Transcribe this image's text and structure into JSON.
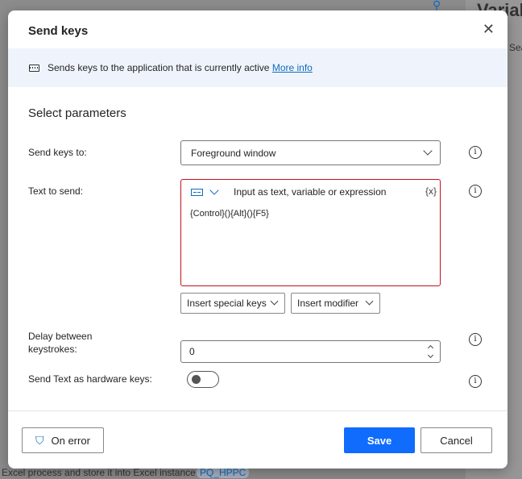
{
  "background": {
    "right_panel_title": "Variab",
    "right_search": "Sea",
    "bottom_text": "Excel process and store it into Excel instance",
    "bottom_variable": "PQ_HPPC"
  },
  "dialog": {
    "title": "Send keys",
    "description": "Sends keys to the application that is currently active",
    "more_info": "More info",
    "section_title": "Select parameters",
    "send_keys_to": {
      "label": "Send keys to:",
      "value": "Foreground window"
    },
    "text_to_send": {
      "label": "Text to send:",
      "mode_hint": "Input as text, variable or expression",
      "var_button": "{x}",
      "value": "{Control}(){Alt}(){F5}"
    },
    "insert_special_keys": "Insert special keys",
    "insert_modifier": "Insert modifier",
    "delay": {
      "label_line1": "Delay between",
      "label_line2": "keystrokes:",
      "value": "0"
    },
    "hardware_keys": {
      "label": "Send Text as hardware keys:",
      "on": false
    },
    "on_error": "On error",
    "save": "Save",
    "cancel": "Cancel"
  },
  "colors": {
    "accent": "#0f6cbd",
    "save": "#0f6cfd",
    "error_border": "#c50f1f",
    "info_band": "#eff4fc"
  }
}
